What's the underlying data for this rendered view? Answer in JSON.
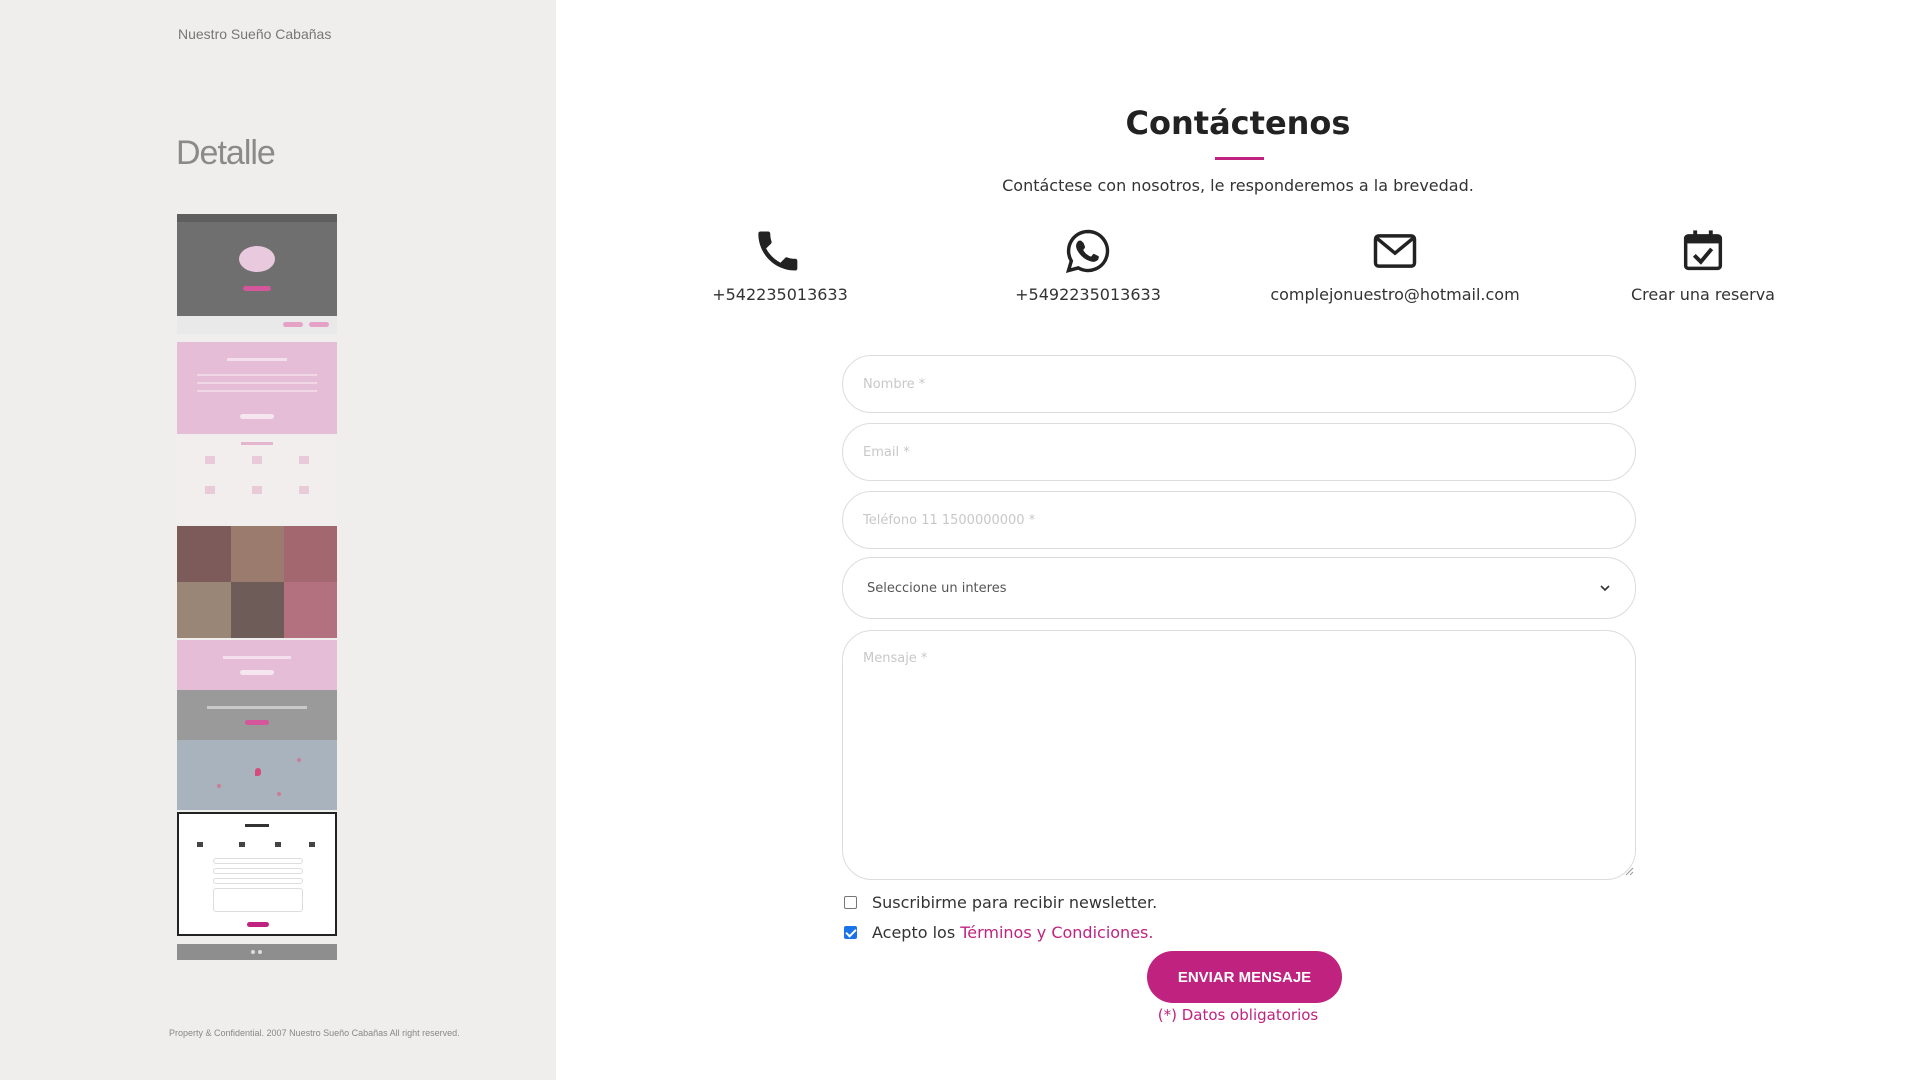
{
  "sidebar": {
    "brand": "Nuestro Sueño Cabañas",
    "title": "Detalle",
    "footer": "Property & Confidential. 2007 Nuestro Sueño Cabañas All right reserved."
  },
  "contact": {
    "heading": "Contáctenos",
    "subheading": "Contáctese con nosotros, le responderemos a la brevedad.",
    "channels": [
      {
        "icon": "phone-icon",
        "label": "+542235013633"
      },
      {
        "icon": "whatsapp-icon",
        "label": "+5492235013633"
      },
      {
        "icon": "envelope-icon",
        "label": "complejonuestro@hotmail.com"
      },
      {
        "icon": "calendar-check-icon",
        "label": "Crear una reserva"
      }
    ],
    "form": {
      "name_placeholder": "Nombre *",
      "email_placeholder": "Email *",
      "phone_placeholder": "Teléfono 11 1500000000 *",
      "interest_selected": "Seleccione un interes",
      "message_placeholder": "Mensaje *",
      "newsletter_label": "Suscribirme para recibir newsletter.",
      "newsletter_checked": false,
      "terms_prefix": "Acepto los",
      "terms_link": "Términos y Condiciones.",
      "terms_checked": true,
      "submit_label": "ENVIAR MENSAJE",
      "required_note": "(*) Datos obligatorios"
    }
  },
  "colors": {
    "accent": "#c0237f",
    "sidebar_bg": "#efeeec",
    "checkbox_blue": "#1a73e8"
  }
}
